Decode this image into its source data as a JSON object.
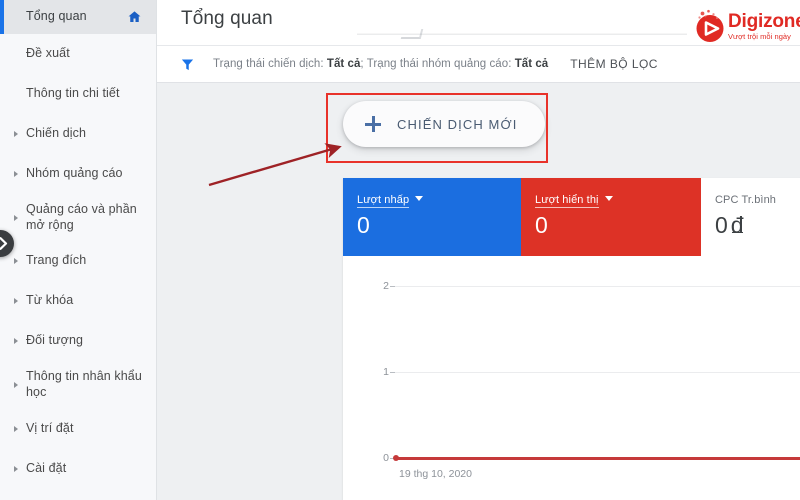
{
  "sidebar": {
    "items": [
      {
        "label": "Tổng quan",
        "active": true,
        "expandable": false,
        "icon": "home-icon"
      },
      {
        "label": "Đề xuất",
        "active": false,
        "expandable": false
      },
      {
        "label": "Thông tin chi tiết",
        "active": false,
        "expandable": false
      },
      {
        "label": "Chiến dịch",
        "active": false,
        "expandable": true
      },
      {
        "label": "Nhóm quảng cáo",
        "active": false,
        "expandable": true
      },
      {
        "label": "Quảng cáo và phần mở rộng",
        "active": false,
        "expandable": true
      },
      {
        "label": "Trang đích",
        "active": false,
        "expandable": true
      },
      {
        "label": "Từ khóa",
        "active": false,
        "expandable": true
      },
      {
        "label": "Đối tượng",
        "active": false,
        "expandable": true
      },
      {
        "label": "Thông tin nhân khẩu học",
        "active": false,
        "expandable": true
      },
      {
        "label": "Vị trí đặt",
        "active": false,
        "expandable": true
      },
      {
        "label": "Cài đặt",
        "active": false,
        "expandable": true
      }
    ],
    "collapse_icon": "chevron-right-icon"
  },
  "header": {
    "title": "Tổng quan"
  },
  "filter_bar": {
    "icon": "filter-icon",
    "campaign_status_label": "Trạng thái chiến dịch:",
    "campaign_status_value": "Tất cả",
    "separator": ";",
    "adgroup_status_label": "Trạng thái nhóm quảng cáo:",
    "adgroup_status_value": "Tất cả",
    "add_filter_label": "THÊM BỘ LỌC"
  },
  "main": {
    "new_campaign_button": {
      "label": "CHIẾN DỊCH MỚI",
      "icon": "plus-icon"
    },
    "cards": [
      {
        "label": "Lượt nhấp",
        "value": "0",
        "color": "#1b6ee0",
        "has_caret": true
      },
      {
        "label": "Lượt hiển thị",
        "value": "0",
        "color": "#dd3226",
        "has_caret": true
      },
      {
        "label": "CPC Tr.bình",
        "value": "0",
        "currency": "đ",
        "color": "#ffffff",
        "has_caret": false
      }
    ]
  },
  "chart_data": {
    "type": "line",
    "title": "",
    "xlabel": "",
    "ylabel": "",
    "x": [
      "19 thg 10, 2020"
    ],
    "tick_labels": [
      "19 thg 10, 2020"
    ],
    "y_ticks": [
      "0",
      "1",
      "2"
    ],
    "ylim": [
      0,
      2
    ],
    "grid": true,
    "legend": "none",
    "series": [
      {
        "name": "Lượt nhấp",
        "color": "#c5393a",
        "values": [
          0,
          0
        ]
      }
    ]
  },
  "annotations": {
    "highlight_rect_color": "#e8322a",
    "arrow_color": "#9e2226"
  },
  "logo": {
    "word": "Digizone",
    "tagline": "Vượt trội mỗi ngày",
    "color": "#e02a24",
    "mark_icon": "play-circle-icon"
  }
}
